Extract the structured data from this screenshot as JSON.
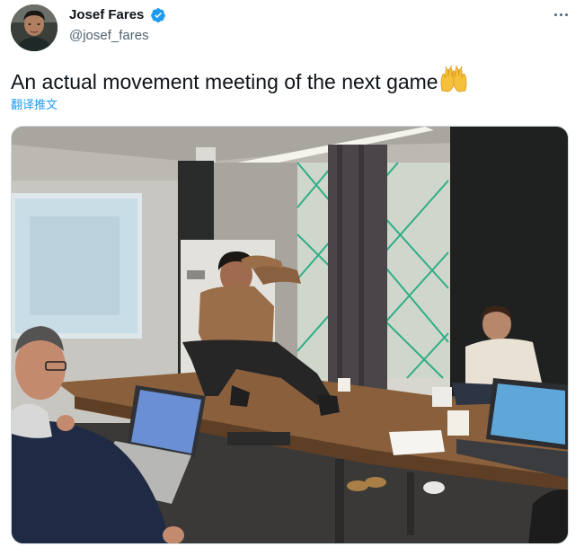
{
  "author": {
    "name": "Josef Fares",
    "handle": "@josef_fares",
    "verified": true,
    "verified_color": "#1d9bf0"
  },
  "menu": {
    "icon": "more-horizontal-icon"
  },
  "tweet": {
    "text": "An actual movement meeting of the next game",
    "emoji": "raising-hands-emoji"
  },
  "translate_label": "翻译推文",
  "media": {
    "alt": "photo"
  },
  "colors": {
    "text": "#0f1419",
    "secondary": "#536471",
    "link": "#1d9bf0",
    "border": "#cfd9de"
  }
}
